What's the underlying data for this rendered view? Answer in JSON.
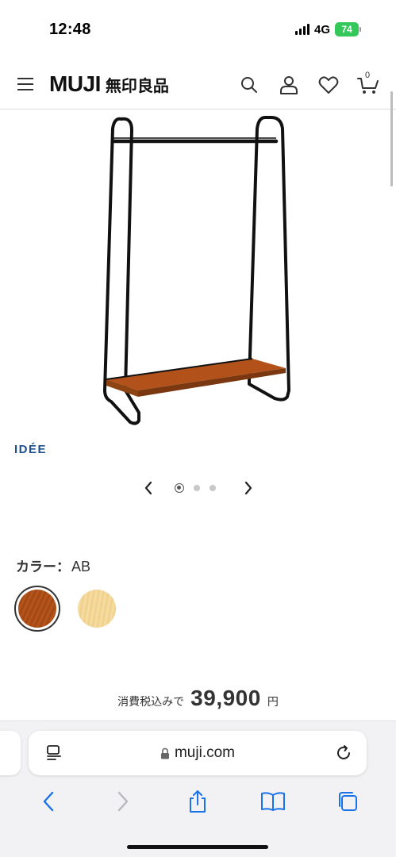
{
  "status_bar": {
    "time": "12:48",
    "network": "4G",
    "battery": "74"
  },
  "header": {
    "logo_latin": "MUJI",
    "logo_kanji": "無印良品",
    "cart_count": "0",
    "icons": [
      "menu-icon",
      "search-icon",
      "account-icon",
      "favorite-heart-icon",
      "cart-icon"
    ]
  },
  "product": {
    "brand": "IDÉE",
    "image_icon": "clothes-rack-illustration"
  },
  "carousel": {
    "active_index": 0,
    "dot_count": 3
  },
  "color": {
    "label": "カラー：",
    "selected": "AB",
    "options": [
      {
        "name": "AB",
        "color": "#b2521a"
      },
      {
        "name": "natural",
        "color": "#f5d89a"
      }
    ]
  },
  "price": {
    "note": "消費税込みで",
    "value": "39,900",
    "unit": "円"
  },
  "browser": {
    "url": "muji.com",
    "tools": [
      "back-icon",
      "forward-icon",
      "share-icon",
      "bookmarks-icon",
      "tabs-icon"
    ]
  },
  "colors": {
    "brand_blue": "#1f4f8f",
    "battery_green": "#34c759",
    "ios_blue": "#1a73e8",
    "shelf_wood": "#b2521a"
  }
}
